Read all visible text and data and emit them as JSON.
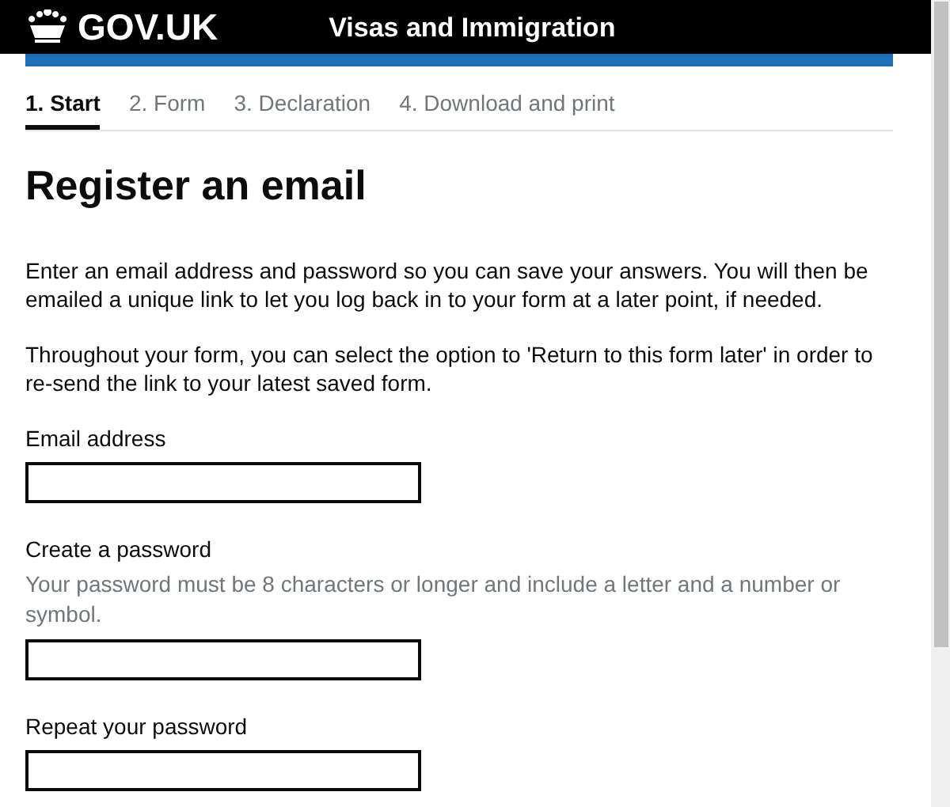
{
  "header": {
    "logo_text": "GOV.UK",
    "service_name": "Visas and Immigration"
  },
  "steps": [
    {
      "label": "1. Start",
      "selected": true
    },
    {
      "label": "2. Form",
      "selected": false
    },
    {
      "label": "3. Declaration",
      "selected": false
    },
    {
      "label": "4. Download and print",
      "selected": false
    }
  ],
  "heading": "Register an email",
  "paragraphs": [
    "Enter an email address and password so you can save your answers. You will then be emailed a unique link to let you log back in to your form at a later point, if needed.",
    "Throughout your form, you can select the option to 'Return to this form later' in order to re-send the link to your latest saved form."
  ],
  "fields": [
    {
      "label": "Email address"
    },
    {
      "label": "Create a password",
      "hint": "Your password must be 8 characters or longer and include a letter and a number or symbol."
    },
    {
      "label": "Repeat your password"
    }
  ]
}
